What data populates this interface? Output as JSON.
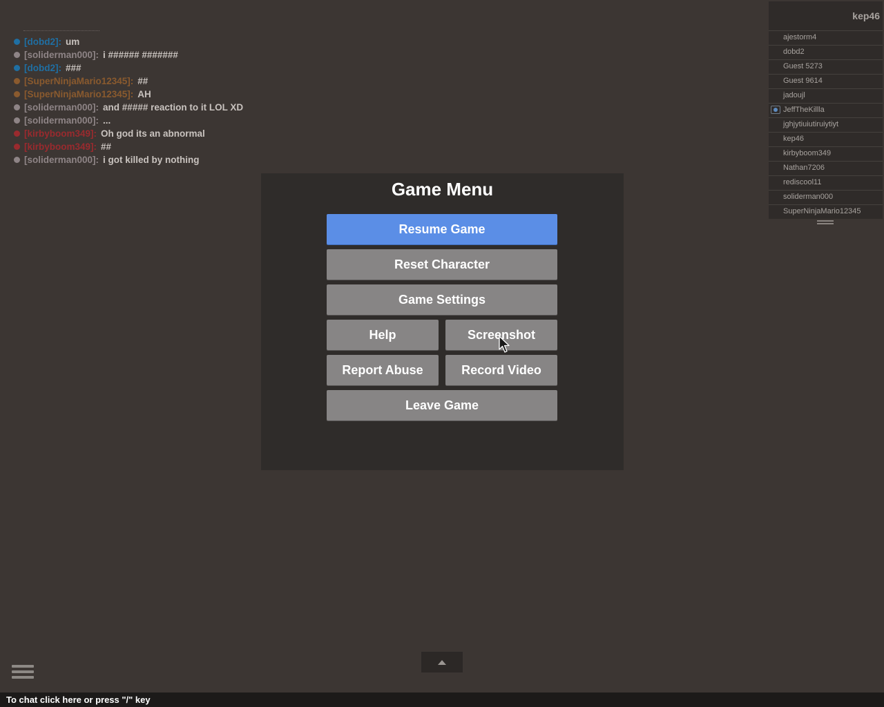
{
  "chat": {
    "messages": [
      {
        "name": "[dobd2]:",
        "text": "um",
        "color": "#1f6fa3"
      },
      {
        "name": "[soliderman000]:",
        "text": "i ###### #######",
        "color": "#8e8486"
      },
      {
        "name": "[dobd2]:",
        "text": "###",
        "color": "#1f6fa3"
      },
      {
        "name": "[SuperNinjaMario12345]:",
        "text": "##",
        "color": "#8a5a2e"
      },
      {
        "name": "[SuperNinjaMario12345]:",
        "text": "AH",
        "color": "#8a5a2e"
      },
      {
        "name": "[soliderman000]:",
        "text": "and ##### reaction to it LOL XD",
        "color": "#8e8486"
      },
      {
        "name": "[soliderman000]:",
        "text": "...",
        "color": "#8e8486"
      },
      {
        "name": "[kirbyboom349]:",
        "text": "Oh god its an abnormal",
        "color": "#9a2a2e"
      },
      {
        "name": "[kirbyboom349]:",
        "text": "##",
        "color": "#9a2a2e"
      },
      {
        "name": "[soliderman000]:",
        "text": "i got killed by nothing",
        "color": "#8e8486"
      }
    ]
  },
  "playerlist": {
    "local_player": "kep46",
    "players": [
      {
        "name": "ajestorm4",
        "badge": false
      },
      {
        "name": "dobd2",
        "badge": false
      },
      {
        "name": "Guest 5273",
        "badge": false
      },
      {
        "name": "Guest 9614",
        "badge": false
      },
      {
        "name": "jadoujl",
        "badge": false
      },
      {
        "name": "JeffTheKillla",
        "badge": true
      },
      {
        "name": "jghjytiuiutiruiytiyt",
        "badge": false
      },
      {
        "name": "kep46",
        "badge": false
      },
      {
        "name": "kirbyboom349",
        "badge": false
      },
      {
        "name": "Nathan7206",
        "badge": false
      },
      {
        "name": "rediscool11",
        "badge": false
      },
      {
        "name": "soliderman000",
        "badge": false
      },
      {
        "name": "SuperNinjaMario12345",
        "badge": false
      }
    ]
  },
  "menu": {
    "title": "Game Menu",
    "resume": "Resume Game",
    "reset": "Reset Character",
    "settings": "Game Settings",
    "help": "Help",
    "screenshot": "Screenshot",
    "report": "Report Abuse",
    "record": "Record Video",
    "leave": "Leave Game"
  },
  "chatbar": {
    "hint": "To chat click here or press \"/\" key"
  },
  "icons": {
    "menu": "hamburger-menu-icon",
    "expand": "chevron-up-icon",
    "cursor": "mouse-cursor-icon"
  },
  "colors": {
    "background": "#3c3633",
    "panel": "#2f2c2a",
    "primary_button": "#5b8ee6",
    "button": "#878585"
  }
}
